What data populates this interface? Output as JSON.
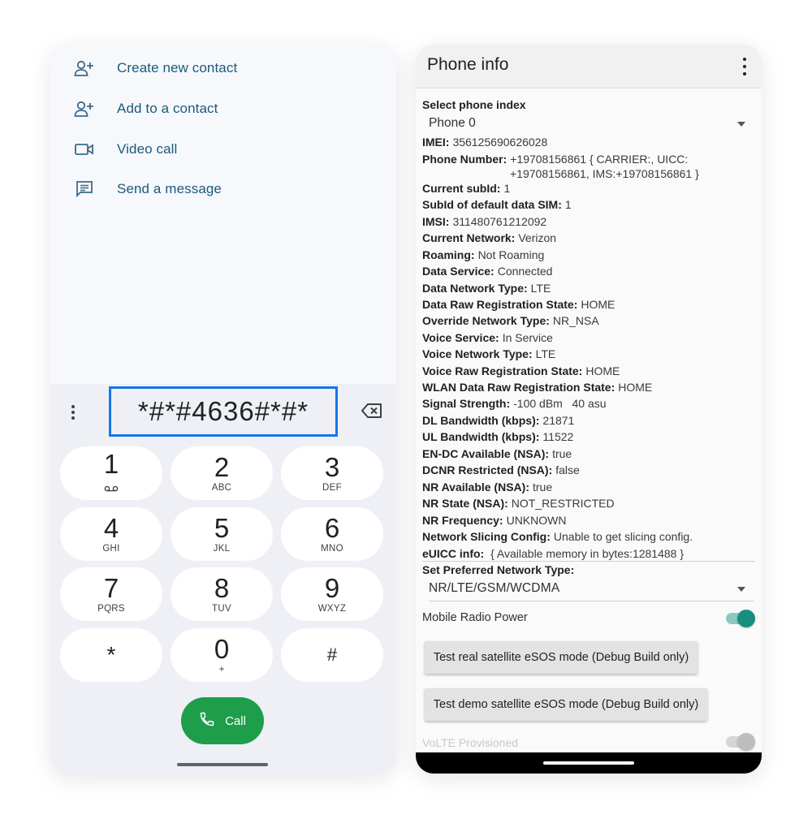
{
  "dialer": {
    "menu": [
      {
        "label": "Create new contact",
        "icon": "add-person-icon"
      },
      {
        "label": "Add to a contact",
        "icon": "add-person-icon"
      },
      {
        "label": "Video call",
        "icon": "video-camera-icon"
      },
      {
        "label": "Send a message",
        "icon": "message-icon"
      }
    ],
    "dialed_number": "*#*#4636#*#*",
    "keys": [
      {
        "digit": "1",
        "letters": ""
      },
      {
        "digit": "2",
        "letters": "ABC"
      },
      {
        "digit": "3",
        "letters": "DEF"
      },
      {
        "digit": "4",
        "letters": "GHI"
      },
      {
        "digit": "5",
        "letters": "JKL"
      },
      {
        "digit": "6",
        "letters": "MNO"
      },
      {
        "digit": "7",
        "letters": "PQRS"
      },
      {
        "digit": "8",
        "letters": "TUV"
      },
      {
        "digit": "9",
        "letters": "WXYZ"
      },
      {
        "digit": "*",
        "letters": ""
      },
      {
        "digit": "0",
        "letters": "+"
      },
      {
        "digit": "#",
        "letters": ""
      }
    ],
    "call_label": "Call",
    "colors": {
      "accent": "#1a73e8",
      "call": "#1e9e4a",
      "menu_text": "#1a5a7a"
    }
  },
  "phone_info": {
    "title": "Phone info",
    "select_label": "Select phone index",
    "selected_phone": "Phone 0",
    "rows": [
      {
        "k": "IMEI:",
        "v": "356125690626028"
      },
      {
        "k": "Phone Number:",
        "v": "+19708156861 { CARRIER:, UICC:",
        "cont": "+19708156861, IMS:+19708156861 }"
      },
      {
        "k": "Current subId:",
        "v": "1"
      },
      {
        "k": "SubId of default data SIM:",
        "v": "1"
      },
      {
        "k": "IMSI:",
        "v": "311480761212092"
      },
      {
        "k": "Current Network:",
        "v": "Verizon"
      },
      {
        "k": "Roaming:",
        "v": "Not Roaming"
      },
      {
        "k": "Data Service:",
        "v": "Connected"
      },
      {
        "k": "Data Network Type:",
        "v": "LTE"
      },
      {
        "k": "Data Raw Registration State:",
        "v": "HOME"
      },
      {
        "k": "Override Network Type:",
        "v": "NR_NSA"
      },
      {
        "k": "Voice Service:",
        "v": "In Service"
      },
      {
        "k": "Voice Network Type:",
        "v": "LTE"
      },
      {
        "k": "Voice Raw Registration State:",
        "v": "HOME"
      },
      {
        "k": "WLAN Data Raw Registration State:",
        "v": "HOME"
      },
      {
        "k": "Signal Strength:",
        "v": "-100 dBm   40 asu"
      },
      {
        "k": "DL Bandwidth (kbps):",
        "v": "21871"
      },
      {
        "k": "UL Bandwidth (kbps):",
        "v": "11522"
      },
      {
        "k": "EN-DC Available (NSA):",
        "v": "true"
      },
      {
        "k": "DCNR Restricted (NSA):",
        "v": "false"
      },
      {
        "k": "NR Available (NSA):",
        "v": "true"
      },
      {
        "k": "NR State (NSA):",
        "v": "NOT_RESTRICTED"
      },
      {
        "k": "NR Frequency:",
        "v": "UNKNOWN"
      },
      {
        "k": "Network Slicing Config:",
        "v": "Unable to get slicing config."
      },
      {
        "k": "eUICC info:",
        "v": " { Available memory in bytes:1281488 }"
      }
    ],
    "pref_label": "Set Preferred Network Type:",
    "pref_value": "NR/LTE/GSM/WCDMA",
    "radio_label": "Mobile Radio Power",
    "radio_on": true,
    "btn_real": "Test real satellite eSOS mode (Debug Build only)",
    "btn_demo": "Test demo satellite eSOS mode (Debug Build only)",
    "volte_label": "VoLTE Provisioned",
    "volte_on": false,
    "colors": {
      "toggle_on": "#15907e"
    }
  }
}
